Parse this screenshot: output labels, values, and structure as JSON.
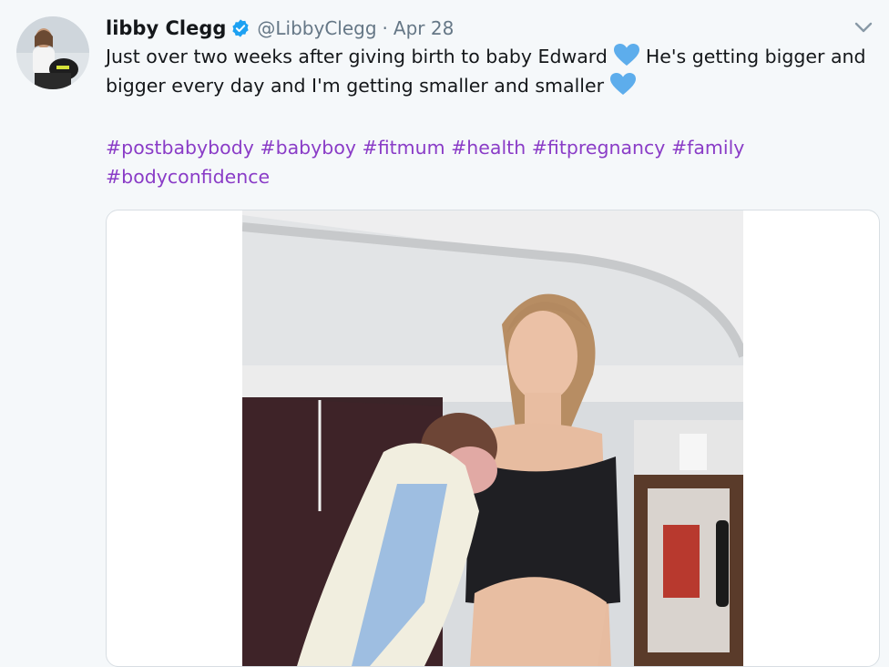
{
  "tweet": {
    "author_name": "libby Clegg",
    "handle": "@LibbyClegg",
    "separator": "·",
    "date": "Apr 28",
    "verified_icon": "verified-badge-icon",
    "menu_icon": "chevron-down-icon",
    "text_line1_part1": "Just over two weeks after giving birth to baby Edward",
    "text_line1_part2": "He's getting bigger and",
    "text_line2": "bigger every day and I'm getting smaller and smaller",
    "emoji": "blue-heart-icon",
    "hashtags": [
      "#postbabybody",
      "#babyboy",
      "#fitmum",
      "#health",
      "#fitpregnancy",
      "#family",
      "#bodyconfidence"
    ]
  },
  "colors": {
    "background": "#f5f8fa",
    "hashtag": "#8a3cc7",
    "verified": "#1da1f2",
    "heart": "#5dadec",
    "muted_text": "#657786"
  }
}
